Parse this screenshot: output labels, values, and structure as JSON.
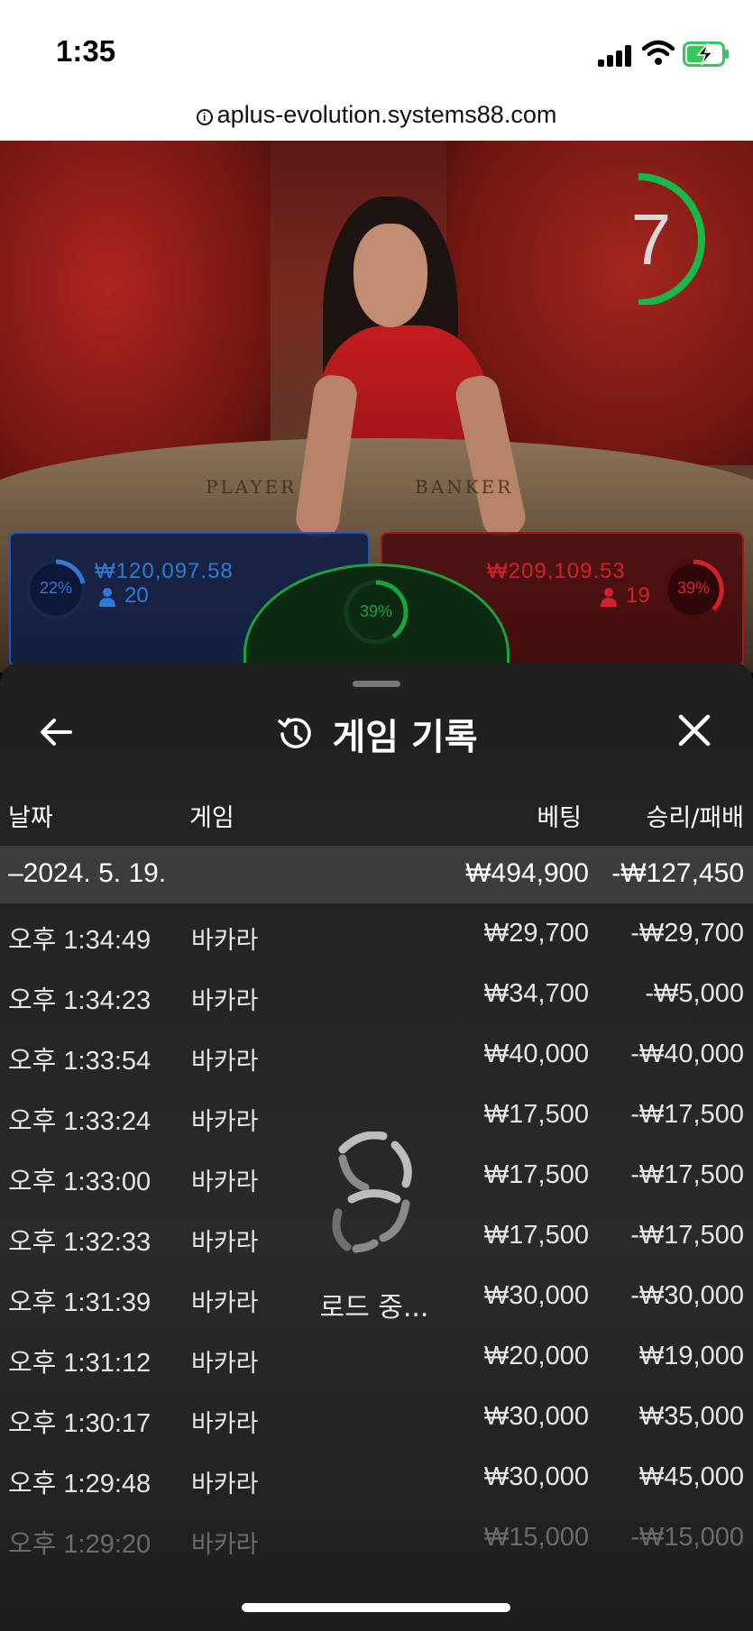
{
  "status_bar": {
    "time": "1:35",
    "icons": [
      "signal-icon",
      "wifi-icon",
      "battery-charging-icon"
    ],
    "battery_color": "#34c759"
  },
  "browser": {
    "url": "aplus-evolution.systems88.com",
    "icon": "info-icon"
  },
  "game": {
    "timer": "7",
    "table_words": {
      "player": "PLAYER",
      "banker": "BANKER"
    },
    "player": {
      "percent": "22%",
      "amount": "₩120,097.58",
      "count": "20",
      "color": "#2f7ad8"
    },
    "tie": {
      "percent": "39%",
      "color": "#1aa23d"
    },
    "banker": {
      "percent": "39%",
      "amount": "₩209,109.53",
      "count": "19",
      "color": "#d3202a"
    }
  },
  "history": {
    "title": "게임 기록",
    "icons": {
      "back": "arrow-left-icon",
      "title": "history-icon",
      "close": "close-icon"
    },
    "columns": {
      "date": "날짜",
      "game": "게임",
      "bet": "베팅",
      "win_loss": "승리/패배"
    },
    "date_group": {
      "date": "–2024. 5. 19.",
      "bet_total": "₩494,900",
      "win_total": "-₩127,450"
    },
    "rows": [
      {
        "time": "오후 1:34:49",
        "game": "바카라",
        "bet": "₩29,700",
        "result": "-₩29,700"
      },
      {
        "time": "오후 1:34:23",
        "game": "바카라",
        "bet": "₩34,700",
        "result": "-₩5,000"
      },
      {
        "time": "오후 1:33:54",
        "game": "바카라",
        "bet": "₩40,000",
        "result": "-₩40,000"
      },
      {
        "time": "오후 1:33:24",
        "game": "바카라",
        "bet": "₩17,500",
        "result": "-₩17,500"
      },
      {
        "time": "오후 1:33:00",
        "game": "바카라",
        "bet": "₩17,500",
        "result": "-₩17,500"
      },
      {
        "time": "오후 1:32:33",
        "game": "바카라",
        "bet": "₩17,500",
        "result": "-₩17,500"
      },
      {
        "time": "오후 1:31:39",
        "game": "바카라",
        "bet": "₩30,000",
        "result": "-₩30,000"
      },
      {
        "time": "오후 1:31:12",
        "game": "바카라",
        "bet": "₩20,000",
        "result": "₩19,000"
      },
      {
        "time": "오후 1:30:17",
        "game": "바카라",
        "bet": "₩30,000",
        "result": "₩35,000"
      },
      {
        "time": "오후 1:29:48",
        "game": "바카라",
        "bet": "₩30,000",
        "result": "₩45,000"
      },
      {
        "time": "오후 1:29:20",
        "game": "바카라",
        "bet": "₩15,000",
        "result": "-₩15,000"
      }
    ],
    "loading_text": "로드 중...",
    "loader_icon": "loading-spinner-icon"
  }
}
